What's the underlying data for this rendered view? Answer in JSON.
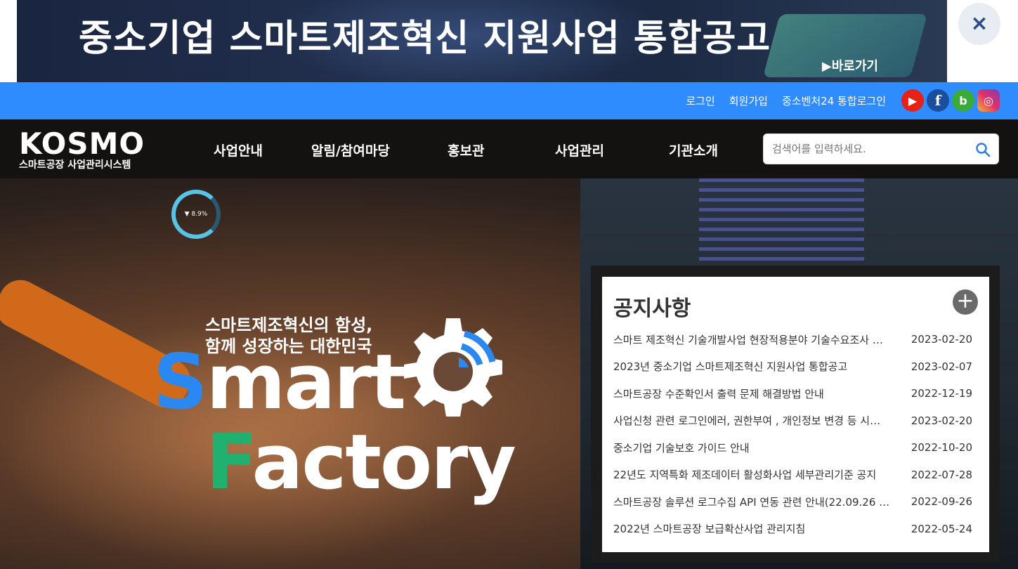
{
  "banner": {
    "title": "중소기업 스마트제조혁신 지원사업 통합공고",
    "link_label": "▶바로가기",
    "close_label": "×"
  },
  "utility": {
    "login": "로그인",
    "signup": "회원가입",
    "integrated_login": "중소벤처24 통합로그인",
    "social": {
      "youtube": "▶",
      "facebook": "f",
      "blog": "b",
      "instagram": "◎"
    }
  },
  "logo": {
    "main": "KOSMO",
    "sub": "스마트공장 사업관리시스템"
  },
  "nav": {
    "items": [
      "사업안내",
      "알림/참여마당",
      "홍보관",
      "사업관리",
      "기관소개"
    ]
  },
  "search": {
    "placeholder": "검색어를 입력하세요."
  },
  "hero": {
    "tagline_line1": "스마트제조혁신의 함성,",
    "tagline_line2": "함께 성장하는 대한민국",
    "smart_cap": "S",
    "smart_rest": "mart",
    "factory_cap": "F",
    "factory_rest": "actory",
    "gauge_value": "▼ 8.9%"
  },
  "notices": {
    "title": "공지사항",
    "more_label": "+",
    "items": [
      {
        "title": "스마트 제조혁신 기술개발사업 현장적용분야 기술수요조사 …",
        "date": "2023-02-20"
      },
      {
        "title": "2023년 중소기업 스마트제조혁신 지원사업 통합공고",
        "date": "2023-02-07"
      },
      {
        "title": "스마트공장 수준확인서 출력 문제 해결방법 안내",
        "date": "2022-12-19"
      },
      {
        "title": "사업신청 관련 로그인에러, 권한부여 , 개인정보 변경 등 시…",
        "date": "2023-02-20"
      },
      {
        "title": "중소기업 기술보호 가이드 안내",
        "date": "2022-10-20"
      },
      {
        "title": "22년도 지역특화 제조데이터 활성화사업 세부관리기준 공지",
        "date": "2022-07-28"
      },
      {
        "title": "스마트공장 솔루션 로그수집 API 연동 관련 안내(22.09.26 …",
        "date": "2022-09-26"
      },
      {
        "title": "2022년 스마트공장 보급확산사업 관리지침",
        "date": "2022-05-24"
      }
    ]
  },
  "colors": {
    "utility_bar": "#2e8cff",
    "nav_bg": "#141210",
    "smart_accent": "#2a88f0",
    "factory_accent": "#20b070"
  }
}
